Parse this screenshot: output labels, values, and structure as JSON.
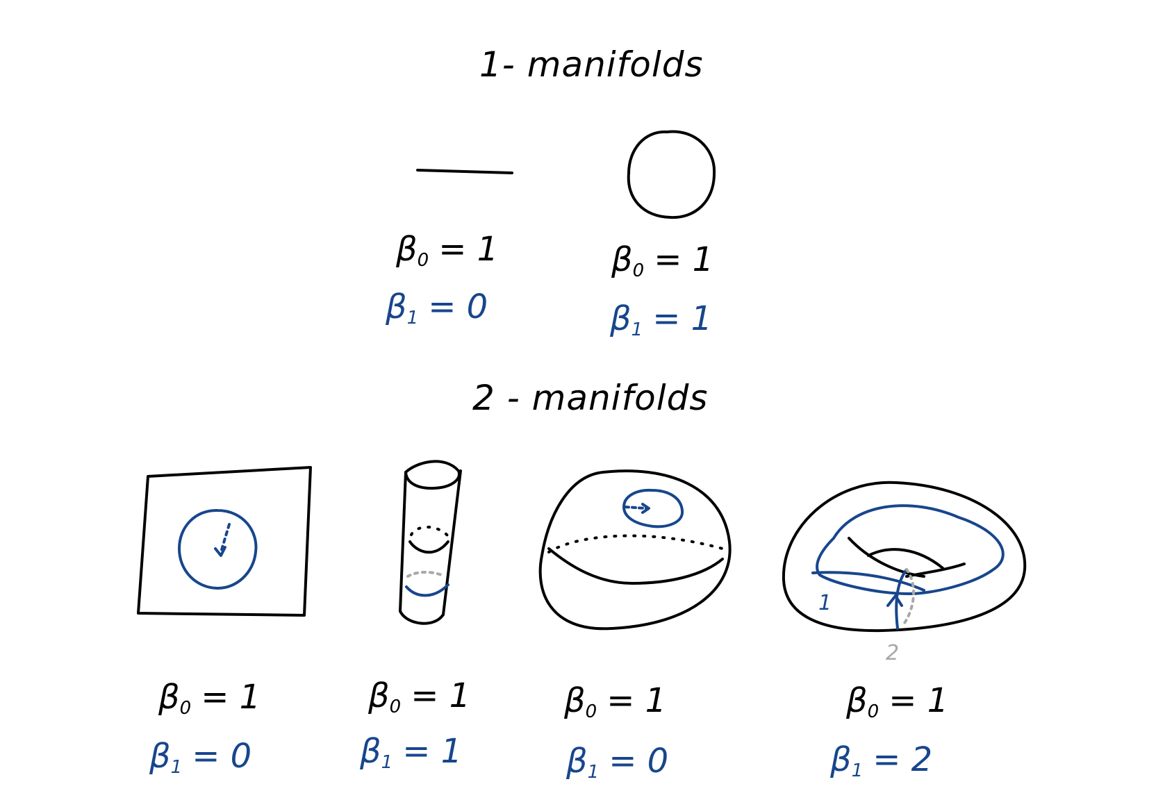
{
  "titles": {
    "one_manifolds": "1- manifolds",
    "two_manifolds": "2 - manifolds"
  },
  "symbols": {
    "beta": "β",
    "sub0": "0",
    "sub1": "1"
  },
  "one_manifolds": [
    {
      "shape": "line segment",
      "b0": "= 1",
      "b1": "= 0"
    },
    {
      "shape": "circle",
      "b0": "= 1",
      "b1": "= 1"
    }
  ],
  "two_manifolds": [
    {
      "shape": "plane",
      "b0": "= 1",
      "b1": "= 0"
    },
    {
      "shape": "cylinder",
      "b0": "= 1",
      "b1": "= 1"
    },
    {
      "shape": "sphere",
      "b0": "= 1",
      "b1": "= 0"
    },
    {
      "shape": "torus",
      "b0": "= 1",
      "b1": "= 2"
    }
  ],
  "torus_loops": {
    "loop1": "1",
    "loop2": "2"
  },
  "colors": {
    "ink": "#000000",
    "blue": "#17468c",
    "grey": "#a8a8a8"
  }
}
